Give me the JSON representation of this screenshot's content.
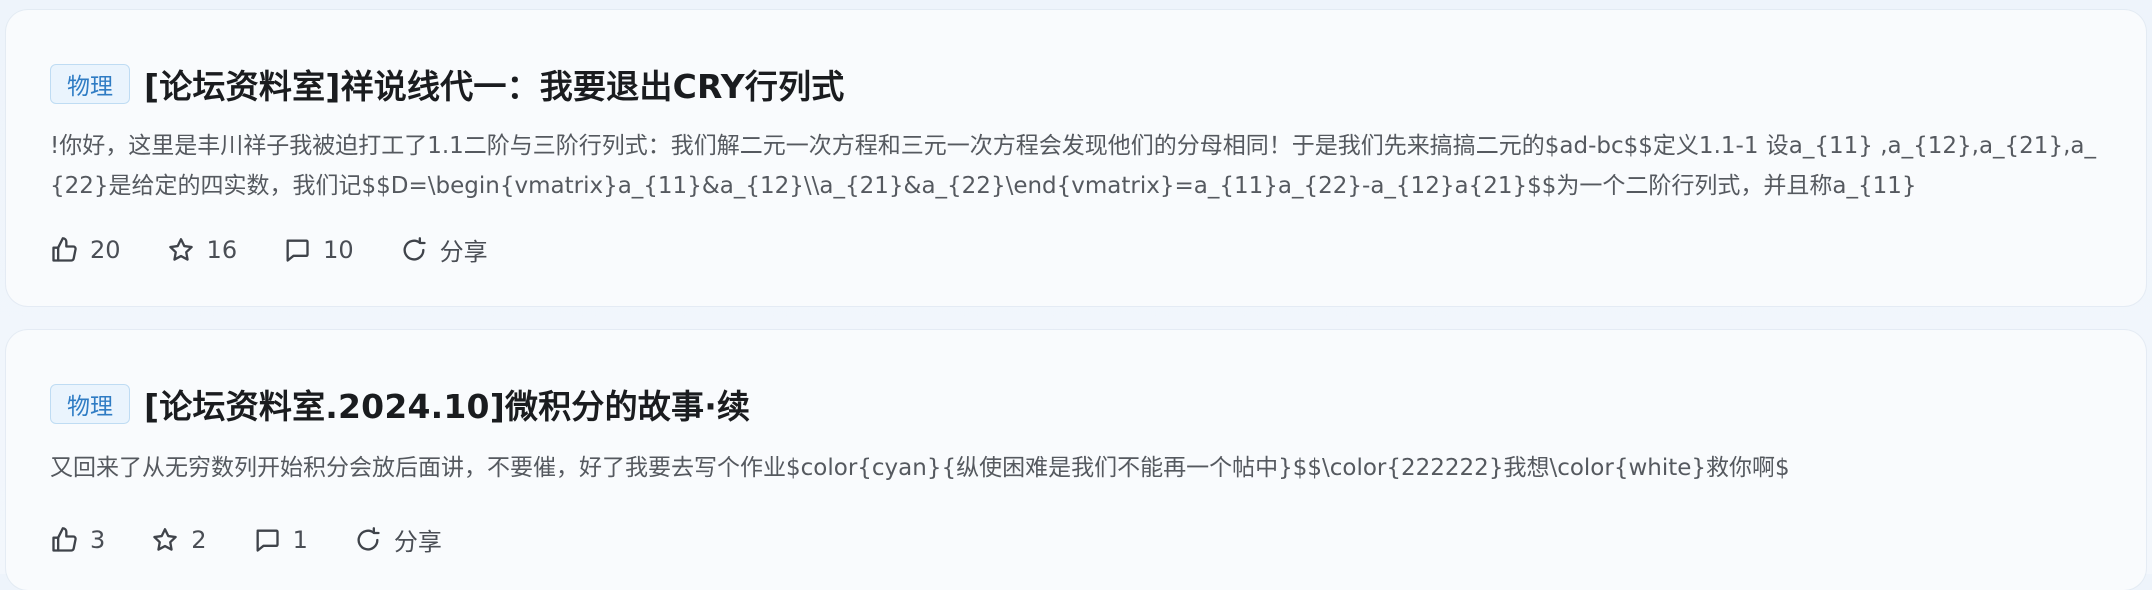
{
  "posts": [
    {
      "tag": "物理",
      "title": "[论坛资料室]祥说线代一：我要退出CRY行列式",
      "excerpt": "!你好，这里是丰川祥子我被迫打工了1.1二阶与三阶行列式：我们解二元一次方程和三元一次方程会发现他们的分母相同！于是我们先来搞搞二元的$ad-bc$$定义1.1-1 设a_{11} ,a_{12},a_{21},a_{22}是给定的四实数，我们记$$D=\\begin{vmatrix}a_{11}&a_{12}\\\\a_{21}&a_{22}\\end{vmatrix}=a_{11}a_{22}-a_{12}a{21}$$为一个二阶行列式，并且称a_{11}",
      "likes": "20",
      "favorites": "16",
      "comments": "10",
      "share_label": "分享"
    },
    {
      "tag": "物理",
      "title": "[论坛资料室.2024.10]微积分的故事·续",
      "excerpt": "又回来了从无穷数列开始积分会放后面讲，不要催，好了我要去写个作业$color{cyan}{纵使困难是我们不能再一个帖中}$$\\color{222222}我想\\color{white}救你啊$",
      "likes": "3",
      "favorites": "2",
      "comments": "1",
      "share_label": "分享"
    }
  ],
  "icons": {
    "like": "thumbs-up-icon",
    "favorite": "star-icon",
    "comment": "comment-icon",
    "share": "share-icon"
  },
  "colors": {
    "tag_text": "#2f7cc4",
    "tag_bg": "#eaf4fd",
    "tag_border": "#bfdcf3",
    "title": "#1a1c1f",
    "excerpt": "#55595f",
    "background": "#eef4fb"
  }
}
